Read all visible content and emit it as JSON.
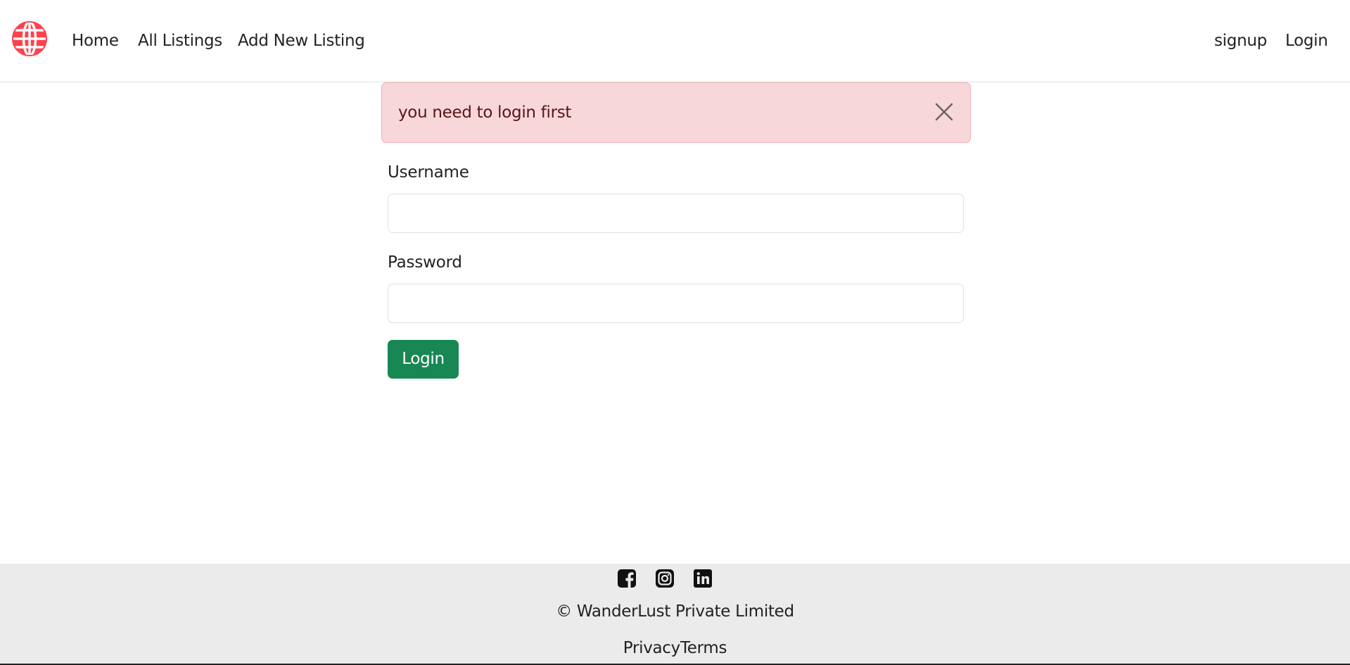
{
  "nav": {
    "logo_icon": "globe-icon",
    "brand_color": "#fe424d",
    "links": [
      "Home",
      "All Listings",
      "Add New Listing"
    ],
    "auth_links": [
      "signup",
      "Login"
    ]
  },
  "alert": {
    "message": "you need to login first",
    "close_icon": "close-icon",
    "background": "#f8d7da",
    "text_color": "#58151c"
  },
  "form": {
    "username_label": "Username",
    "username_value": "",
    "password_label": "Password",
    "password_value": "",
    "submit_label": "Login",
    "submit_color": "#198754"
  },
  "footer": {
    "social_icons": [
      "facebook-icon",
      "instagram-icon",
      "linkedin-icon"
    ],
    "copyright": "© WanderLust Private Limited",
    "links": [
      "Privacy",
      "Terms"
    ],
    "background": "#ebebeb"
  }
}
